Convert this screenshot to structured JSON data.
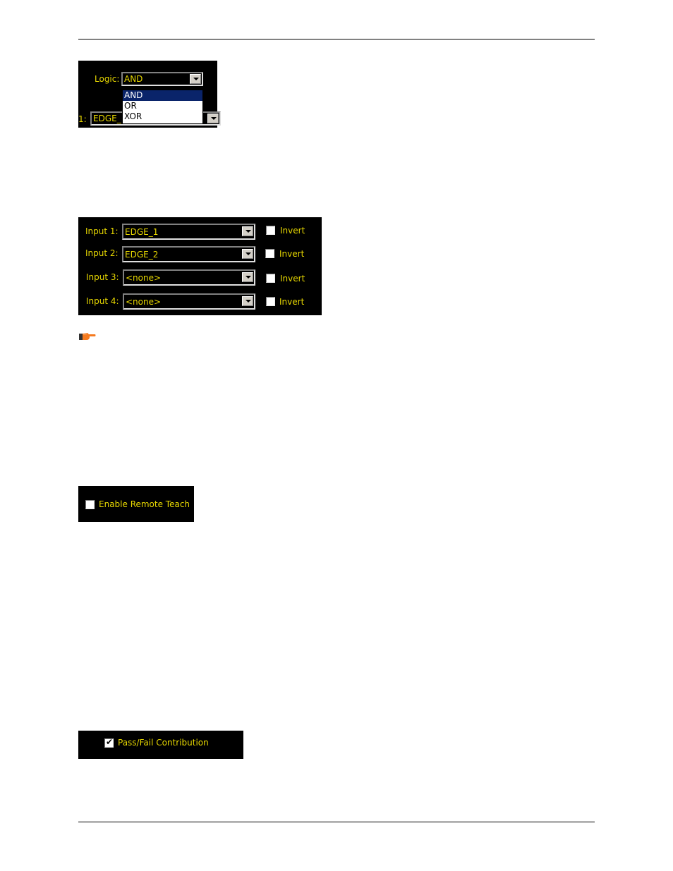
{
  "logic_panel": {
    "label": "Logic:",
    "selected": "AND",
    "options": [
      "AND",
      "OR",
      "XOR"
    ],
    "partial_label": "1:",
    "partial_value": "EDGE_"
  },
  "inputs_panel": {
    "rows": [
      {
        "label": "Input 1:",
        "value": "EDGE_1",
        "invert_label": "Invert",
        "invert_checked": false
      },
      {
        "label": "Input 2:",
        "value": "EDGE_2",
        "invert_label": "Invert",
        "invert_checked": false
      },
      {
        "label": "Input 3:",
        "value": "<none>",
        "invert_label": "Invert",
        "invert_checked": false
      },
      {
        "label": "Input 4:",
        "value": "<none>",
        "invert_label": "Invert",
        "invert_checked": false
      }
    ]
  },
  "note_icon": "pointing-hand-icon",
  "remote_teach": {
    "label": "Enable Remote Teach",
    "checked": false
  },
  "pass_fail": {
    "label": "Pass/Fail Contribution",
    "checked": true
  },
  "colors": {
    "panel_bg": "#000000",
    "label_text": "#e8d800",
    "selection": "#0a246a"
  }
}
